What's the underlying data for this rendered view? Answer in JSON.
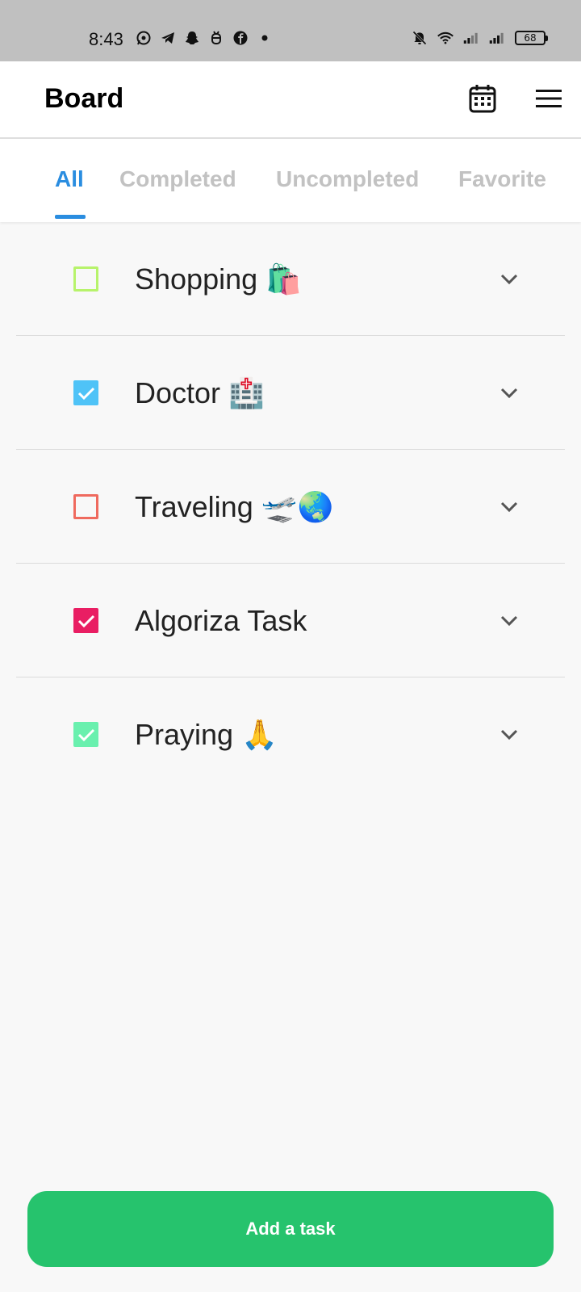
{
  "status_bar": {
    "time": "8:43",
    "left_icons": [
      "whatsapp-icon",
      "telegram-icon",
      "snapchat-icon",
      "bug-icon",
      "facebook-icon",
      "dot-icon"
    ],
    "right_icons": [
      "mute-icon",
      "wifi-icon",
      "signal-icon",
      "signal-icon"
    ],
    "battery": "68"
  },
  "app_bar": {
    "title": "Board",
    "calendar_icon": "calendar-icon",
    "menu_icon": "hamburger-menu-icon"
  },
  "tabs": [
    {
      "label": "All",
      "active": true
    },
    {
      "label": "Completed",
      "active": false
    },
    {
      "label": "Uncompleted",
      "active": false
    },
    {
      "label": "Favorite",
      "active": false
    }
  ],
  "tasks": [
    {
      "label": "Shopping 🛍️",
      "checked": false,
      "color": "#b7f36b"
    },
    {
      "label": "Doctor 🏥",
      "checked": true,
      "color": "#4fc3f7"
    },
    {
      "label": "Traveling 🛫🌏",
      "checked": false,
      "color": "#ef6a5e"
    },
    {
      "label": "Algoriza Task",
      "checked": true,
      "color": "#e91e63"
    },
    {
      "label": "Praying 🙏",
      "checked": true,
      "color": "#69f0ae"
    }
  ],
  "add_button": {
    "label": "Add a task"
  },
  "colors": {
    "accent": "#2a8de0",
    "add_button": "#26c36d",
    "status_bar": "#c0c0c0"
  }
}
